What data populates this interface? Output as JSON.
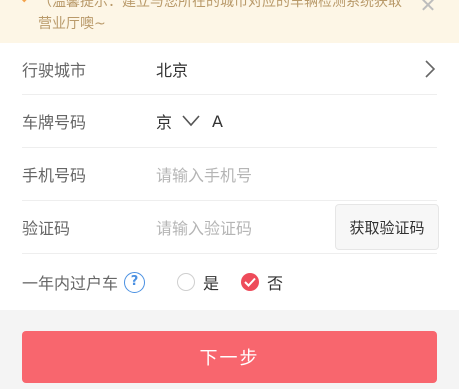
{
  "notice": {
    "text": "（温馨提示：建立与您所在的城市对应的车辆检测系统获取营业厅噢~",
    "text_line2": "营业厅噢~",
    "close_icon": "close-icon",
    "bell_icon": "bell-icon"
  },
  "form": {
    "city": {
      "label": "行驶城市",
      "value": "北京"
    },
    "plate": {
      "label": "车牌号码",
      "province": "京",
      "letter": "A"
    },
    "phone": {
      "label": "手机号码",
      "placeholder": "请输入手机号"
    },
    "code": {
      "label": "验证码",
      "placeholder": "请输入验证码",
      "button": "获取验证码"
    },
    "transfer": {
      "label": "一年内过户车",
      "help": "?",
      "options": [
        {
          "label": "是",
          "checked": false
        },
        {
          "label": "否",
          "checked": true
        }
      ]
    }
  },
  "next_button": "下一步",
  "colors": {
    "accent": "#f8666e",
    "radio_checked": "#ee4b5a",
    "help_blue": "#4a90e2",
    "notice_bg": "#fdf6e6"
  }
}
